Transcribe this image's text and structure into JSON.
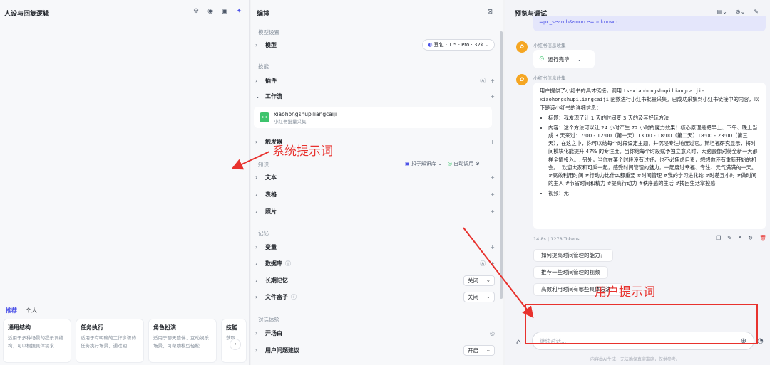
{
  "left": {
    "title": "人设与回复逻辑",
    "header_icons": [
      "robot-icon",
      "lightbulb-icon",
      "layout-icon",
      "magic-icon"
    ],
    "tabs": [
      "推荐",
      "个人"
    ],
    "templates": [
      {
        "title": "通用结构",
        "desc": "适用于多种场景的提示词结构，可以根据具体需求"
      },
      {
        "title": "任务执行",
        "desc": "适用于有明确的工作步骤的任务执行场景，通过明"
      },
      {
        "title": "角色扮演",
        "desc": "适用于聊天陪伴、互动娱乐场景，可帮助模型轻松"
      },
      {
        "title": "技能",
        "desc": "获取"
      }
    ]
  },
  "mid": {
    "title": "编排",
    "sections": {
      "model": "模型设置",
      "skills": "技能",
      "knowledge": "知识",
      "memory": "记忆",
      "dialog": "对话体验"
    },
    "model_label": "模型",
    "model_value": "豆包 · 1.5 · Pro · 32k",
    "plugin_label": "插件",
    "workflow_label": "工作流",
    "workflow_name": "xiaohongshupiliangcaiji",
    "workflow_desc": "小红书批量采集",
    "trigger_label": "触发器",
    "kb_source": "扣子知识库",
    "kb_auto": "自动调用",
    "text_label": "文本",
    "table_label": "表格",
    "image_label": "照片",
    "var_label": "变量",
    "db_label": "数据库",
    "longmem_label": "长期记忆",
    "longmem_value": "关闭",
    "filebox_label": "文件盒子",
    "filebox_value": "关闭",
    "opening_label": "开场白",
    "suggest_label": "用户问题建议",
    "suggest_value": "开启"
  },
  "right": {
    "title": "预览与调试",
    "top_snippet": "=pc_search&source=unknown",
    "msg1_name": "小红书信息收集",
    "status_text": "运行完毕",
    "msg2_name": "小红书信息收集",
    "answer_intro_a": "用户提供了小红书的具体链接，调用 ",
    "answer_intro_code": "ts-xiaohongshupiliangcaiji-xiaohongshupiliangcaiji",
    "answer_intro_b": " 函数进行小红书批量采集。已成功采集到小红书链接中的内容，以下是该小红书的详细信息：",
    "answer_items": [
      "标题：我发现了让 1 天的时间变 3 天的及其好玩方法",
      "内容：这个方法可以让 24 小时产生 72 小时的魔力效果！核心原理是把早上、下午、晚上当成 3 天来过：7:00 - 12:00（第一天）13:00 - 18:00（第二天）18:00 - 23:00（第三天），在这之中，你可以给每个时段设定主题，并沉浸专注地度过它。斯坦福研究显示，将时间模块化能提升 47% 的专注度。当你给每个时段赋予独立意义时，大脑会像对待全新一天那样全情投入。. 另外，当你在某个时段没有过好，也不必焦虑自责，想想你还有重新开始的机会。. 欢迎大家和可乘一起，感受时间管理的魅力，一起度过幸福、专注、元气满满的一天。#高效利用时间 #行动力比什么都重要 #时间管理 #我的学习进化论 #时差五小时 #做时间的主人 #节省时间和精力 #提高行动力 #秩序感的生活 #找回生活掌控感",
      "视频：无"
    ],
    "meta": "14.8s | 1278 Tokens",
    "suggestions": [
      "如何提高时间管理的能力？",
      "推荐一些时间管理的视频",
      "高效利用时间有哪些具体方法？"
    ],
    "input_placeholder": "继续对话...",
    "footnote": "内容由AI生成，无法确保真实准确，仅供参考。"
  },
  "annotations": {
    "system": "系统提示词",
    "user": "用户提示词",
    "color": "#e8322e"
  }
}
